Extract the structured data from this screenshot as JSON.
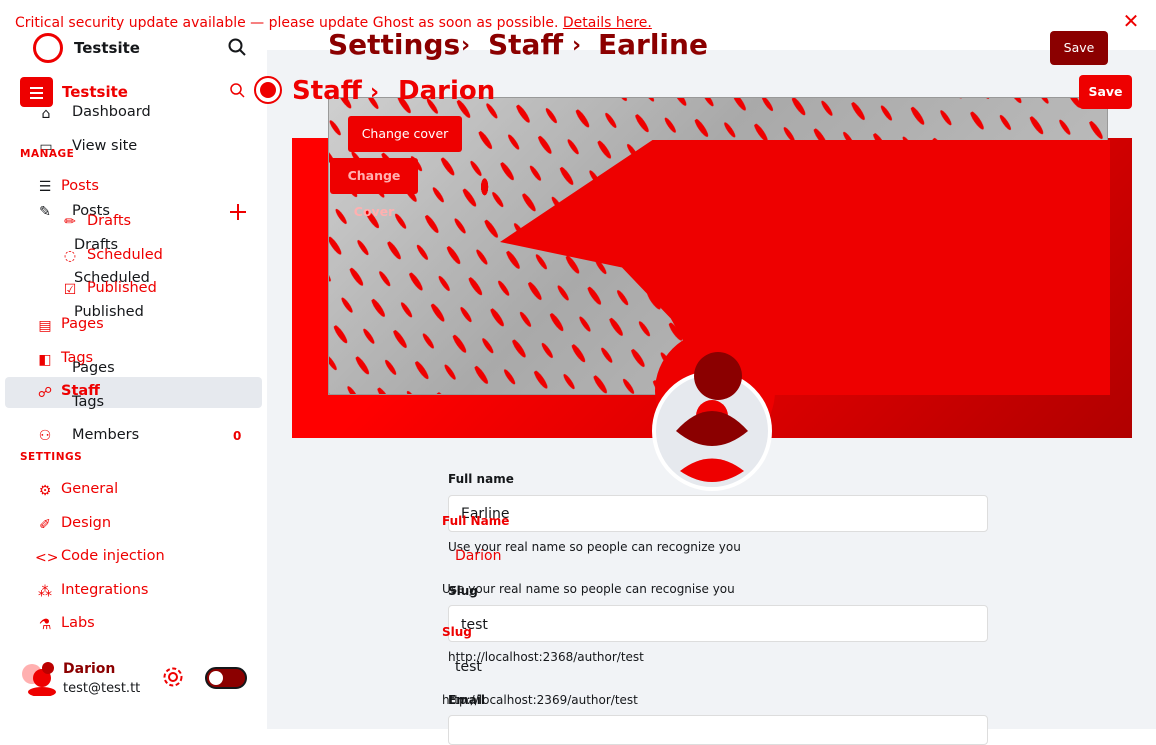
{
  "banner": {
    "text": "Critical security update available — please update Ghost as soon as possible. ",
    "link": "Details here."
  },
  "sidebar": {
    "site_name_top": "Testsite",
    "site_name": "Testsite",
    "nav_top": [
      {
        "label": "Dashboard",
        "icon": "home-icon"
      },
      {
        "label": "View site",
        "icon": "window-icon"
      }
    ],
    "manage_label": "MANAGE",
    "posts_label_a": "Posts",
    "posts_label_b": "Posts",
    "drafts_a": "Drafts",
    "drafts_b": "Drafts",
    "scheduled_a": "Scheduled",
    "scheduled_b": "Scheduled",
    "published_a": "Published",
    "published_b": "Published",
    "pages_a": "Pages",
    "pages_b": "Pages",
    "tags_a": "Tags",
    "tags_b": "Tags",
    "staff": "Staff",
    "members": "Members",
    "members_count": "0",
    "settings_label": "SETTINGS",
    "settings_items": [
      "General",
      "Design",
      "Code injection",
      "Integrations",
      "Labs"
    ],
    "user_name": "Darion",
    "user_email": "test@test.tt"
  },
  "header_back": {
    "crumb1": "Settings",
    "crumb2": "Staff",
    "crumb3": "Earline",
    "save": "Save"
  },
  "header_front": {
    "crumb1": "Staff",
    "crumb2": "Darion",
    "save": "Save"
  },
  "cover": {
    "change_back": "Change cover",
    "change_front": "Change Cover"
  },
  "form_back": {
    "full_name_label": "Full name",
    "full_name_value": "Earline",
    "full_name_hint": "Use your real name so people can recognize you",
    "slug_label": "Slug",
    "slug_value": "test",
    "slug_hint": "http://localhost:2368/author/test"
  },
  "form_front": {
    "full_name_label": "Full Name",
    "full_name_value": "Darion",
    "full_name_hint": "Use your real name so people can recognise you",
    "slug_label": "Slug",
    "slug_value": "test",
    "slug_hint": "http://localhost:2369/author/test",
    "email_label": "Email"
  },
  "colors": {
    "accent": "#ee0000",
    "dark_accent": "#8b0000",
    "sidebar_active": "#e6e9ee",
    "main_bg": "#f1f3f6"
  }
}
